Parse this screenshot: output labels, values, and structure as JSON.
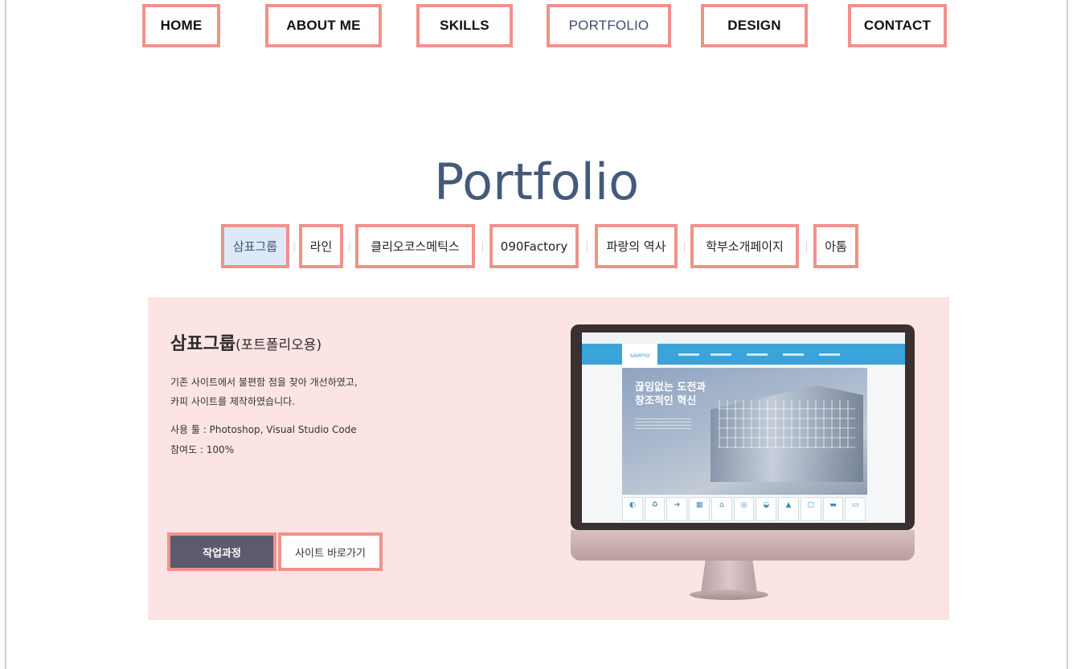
{
  "nav": {
    "items": [
      {
        "label": "HOME"
      },
      {
        "label": "ABOUT ME"
      },
      {
        "label": "SKILLS"
      },
      {
        "label": "PORTFOLIO"
      },
      {
        "label": "DESIGN"
      },
      {
        "label": "CONTACT"
      }
    ],
    "active": "PORTFOLIO"
  },
  "page": {
    "title": "Portfolio"
  },
  "tabs": {
    "items": [
      {
        "label": "삼표그룹"
      },
      {
        "label": "라인"
      },
      {
        "label": "클리오코스메틱스"
      },
      {
        "label": "090Factory"
      },
      {
        "label": "파랑의 역사"
      },
      {
        "label": "학부소개페이지"
      },
      {
        "label": "아톰"
      }
    ],
    "active": "삼표그룹"
  },
  "project": {
    "title": "삼표그룹",
    "subtitle": "(포트폴리오용)",
    "desc_line1": "기존 사이트에서 불편함 점을 찾아 개선하였고,",
    "desc_line2": "카피 사이트를 제작하였습니다.",
    "tools": "사용 툴 : Photoshop, Visual Studio Code",
    "participation": "참여도 : 100%",
    "btn_process": "작업과정",
    "btn_site": "사이트 바로가기"
  },
  "preview": {
    "logo": "SAMPYO",
    "hero_line1": "끊임없는 도전과",
    "hero_line2": "창조적인 혁신"
  },
  "colors": {
    "highlight_border": "#f0928a",
    "title": "#445a7a",
    "panel_bg": "#fbe4e3",
    "button_dark": "#5b5a6e",
    "active_tab_bg": "#dde9f7"
  }
}
